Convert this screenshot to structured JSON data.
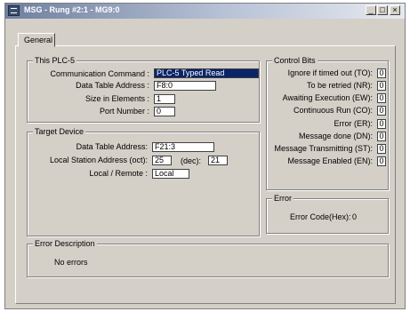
{
  "window": {
    "title": "MSG - Rung #2:1 - MG9:0",
    "minimize_label": "_",
    "maximize_label": "□",
    "close_label": "×"
  },
  "tabs": [
    {
      "label": "General"
    }
  ],
  "this_plc": {
    "legend": "This PLC-5",
    "communication_command_label": "Communication Command :",
    "communication_command_value": "PLC-5 Typed Read",
    "data_table_address_label": "Data Table Address :",
    "data_table_address_value": "F8:0",
    "size_in_elements_label": "Size in Elements :",
    "size_in_elements_value": "1",
    "port_number_label": "Port Number :",
    "port_number_value": "0"
  },
  "target_device": {
    "legend": "Target Device",
    "data_table_address_label": "Data Table Address:",
    "data_table_address_value": "F21:3",
    "local_station_address_label": "Local Station Address (oct):",
    "local_station_address_value": "25",
    "dec_label": "(dec):",
    "dec_value": "21",
    "local_remote_label": "Local / Remote :",
    "local_remote_value": "Local"
  },
  "control_bits": {
    "legend": "Control Bits",
    "items": [
      {
        "label": "Ignore if timed out (TO):",
        "value": "0"
      },
      {
        "label": "To be retried (NR):",
        "value": "0"
      },
      {
        "label": "Awaiting Execution (EW):",
        "value": "0"
      },
      {
        "label": "Continuous Run (CO):",
        "value": "0"
      },
      {
        "label": "Error (ER):",
        "value": "0"
      },
      {
        "label": "Message done (DN):",
        "value": "0"
      },
      {
        "label": "Message Transmitting (ST):",
        "value": "0"
      },
      {
        "label": "Message Enabled (EN):",
        "value": "0"
      }
    ]
  },
  "error": {
    "legend": "Error",
    "code_label": "Error Code(Hex):",
    "code_value": "0"
  },
  "error_description": {
    "legend": "Error Description",
    "text": "No errors"
  }
}
